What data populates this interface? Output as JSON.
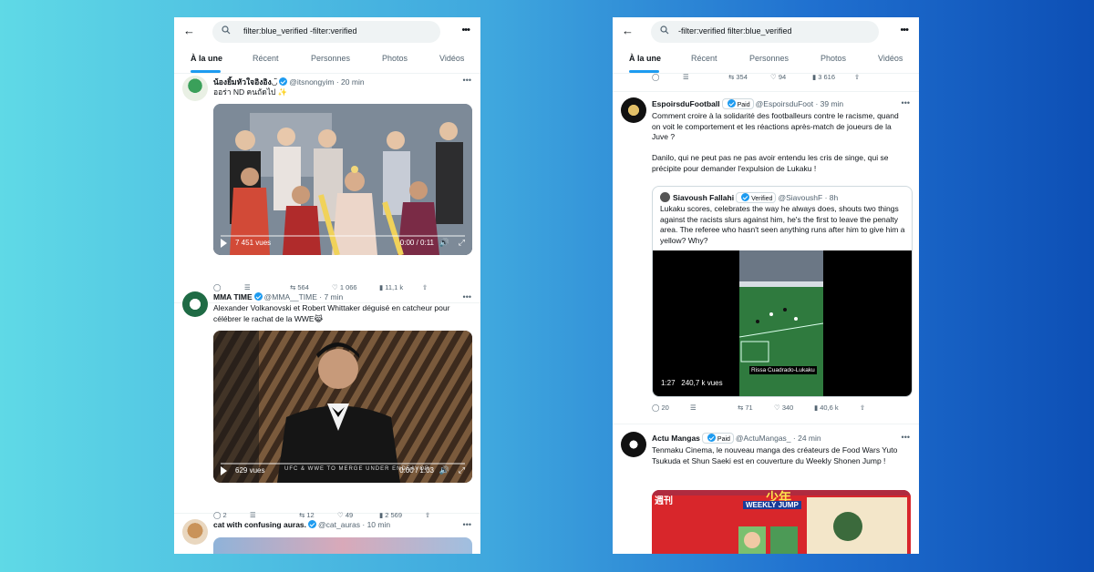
{
  "left": {
    "search_query": "filter:blue_verified -filter:verified",
    "tabs": [
      "À la une",
      "Récent",
      "Personnes",
      "Photos",
      "Vidéos"
    ],
    "tweets": [
      {
        "name": "น้องยิ้มหัวใจอิงอิง◡̈",
        "handle": "@itsnongyim",
        "time": "20 min",
        "text": "ออร่า ND คนถัดไป ✨",
        "video_views": "7 451 vues",
        "video_time": "0:00 / 0:11",
        "replies": "",
        "retweets": "564",
        "likes": "1 066",
        "views": "11,1 k"
      },
      {
        "name": "MMA TIME",
        "handle": "@MMA__TIME",
        "time": "7 min",
        "text": "Alexander Volkanovski et Robert Whittaker déguisé en catcheur pour célébrer le rachat de la WWE😹",
        "video_caption": "UFC & WWE TO MERGE UNDER ENDEAVOR",
        "video_views": "629 vues",
        "video_time": "0:00 / 1:03",
        "replies": "2",
        "retweets": "12",
        "likes": "49",
        "views": "2 569"
      },
      {
        "name": "cat with confusing auras.",
        "handle": "@cat_auras",
        "time": "10 min"
      }
    ]
  },
  "right": {
    "search_query": "-filter:verified filter:blue_verified",
    "tabs": [
      "À la une",
      "Récent",
      "Personnes",
      "Photos",
      "Vidéos"
    ],
    "prev_stats": {
      "retweets": "354",
      "likes": "94",
      "views": "3 616"
    },
    "tweets": [
      {
        "name": "EspoirsduFootball",
        "badge": "Paid",
        "handle": "@EspoirsduFoot",
        "time": "39 min",
        "text": "Comment croire à la solidarité des footballeurs contre le racisme, quand on voit le comportement et les réactions après-match de joueurs de la Juve ?\n\nDanilo, qui ne peut pas ne pas avoir entendu les cris de singe, qui se précipite pour demander l'expulsion de Lukaku !",
        "quote": {
          "name": "Siavoush Fallahi",
          "badge": "Verified",
          "handle": "@SiavoushF",
          "time": "8h",
          "text": "Lukaku scores, celebrates the way he always does, shouts two things against the racists slurs against him, he's the first to leave the penalty area. The referee who hasn't seen anything runs after him to give him a yellow? Why?",
          "video_duration": "1:27",
          "video_views": "240,7 k vues",
          "video_caption": "Rissa Cuadrado-Lukaku"
        },
        "replies": "20",
        "retweets": "71",
        "likes": "340",
        "views": "40,6 k"
      },
      {
        "name": "Actu Mangas",
        "badge": "Paid",
        "handle": "@ActuMangas_",
        "time": "24 min",
        "text": "Tenmaku Cinema, le nouveau manga des créateurs de Food Wars Yuto Tsukuda et Shun Saeki est en couverture du Weekly Shonen Jump !",
        "cover_text": [
          "週刊",
          "少年",
          "WEEKLY JUMP"
        ]
      }
    ]
  },
  "colors": {
    "accent": "#1d9bf0",
    "text": "#0f1419",
    "muted": "#536471"
  }
}
